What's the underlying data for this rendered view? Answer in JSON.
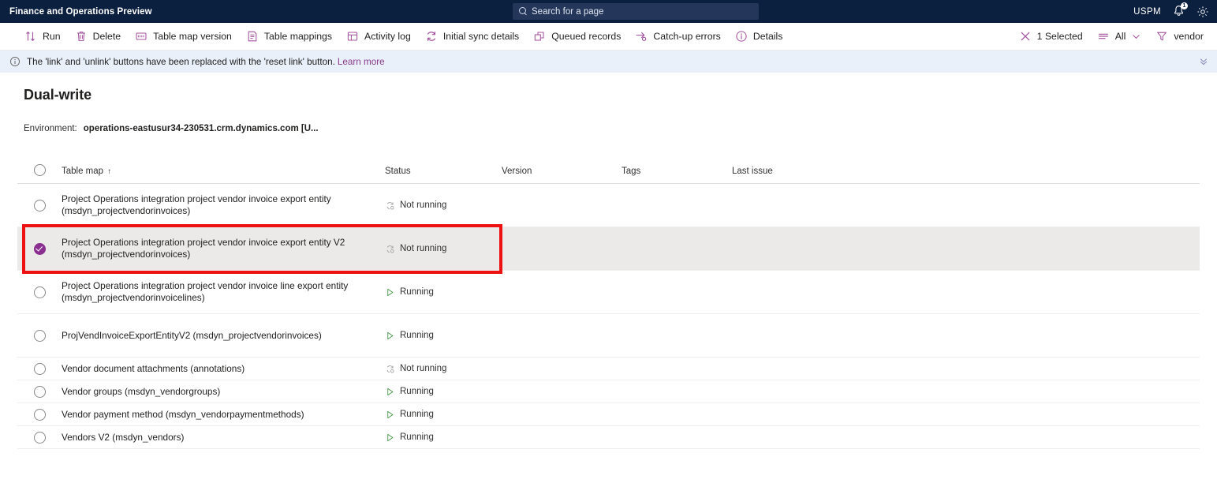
{
  "topbar": {
    "app_title": "Finance and Operations Preview",
    "search_placeholder": "Search for a page",
    "search_icon": "search-icon",
    "user_initials": "USPM",
    "notification_icon": "bell-icon",
    "notification_count": "1",
    "settings_icon": "gear-icon",
    "bg_color": "#0b1f3f"
  },
  "toolbar": {
    "items": [
      {
        "label": "Run",
        "icon": "sort-arrows-icon"
      },
      {
        "label": "Delete",
        "icon": "trash-icon"
      },
      {
        "label": "Table map version",
        "icon": "version-card-icon"
      },
      {
        "label": "Table mappings",
        "icon": "list-document-icon"
      },
      {
        "label": "Activity log",
        "icon": "activity-grid-icon"
      },
      {
        "label": "Initial sync details",
        "icon": "sync-refresh-icon"
      },
      {
        "label": "Queued records",
        "icon": "stacked-squares-icon"
      },
      {
        "label": "Catch-up errors",
        "icon": "arrow-target-icon"
      },
      {
        "label": "Details",
        "icon": "info-circle-icon"
      }
    ],
    "right_items": [
      {
        "label": "1 Selected",
        "icon": "close-x-icon"
      },
      {
        "label": "All",
        "icon": "filter-lines-icon",
        "chevron": "chevron-down-icon"
      },
      {
        "label": "vendor",
        "icon": "funnel-filter-icon"
      }
    ],
    "icon_color": "#a4519f"
  },
  "message_bar": {
    "icon": "info-circle-icon",
    "text": "The 'link' and 'unlink' buttons have been replaced with the 'reset link' button.",
    "link_text": "Learn more",
    "collapse_icon": "double-chevron-down-icon",
    "bg_color": "#e9f0fa"
  },
  "page": {
    "title": "Dual-write",
    "environment_label": "Environment:",
    "environment_value": "operations-eastusur34-230531.crm.dynamics.com [U..."
  },
  "grid": {
    "columns": [
      {
        "key": "check",
        "label": ""
      },
      {
        "key": "name",
        "label": "Table map",
        "sort": "↑"
      },
      {
        "key": "status",
        "label": "Status"
      },
      {
        "key": "version",
        "label": "Version"
      },
      {
        "key": "tags",
        "label": "Tags"
      },
      {
        "key": "issue",
        "label": "Last issue"
      }
    ],
    "rows": [
      {
        "name": "Project Operations integration project vendor invoice export entity (msdyn_projectvendorinvoices)",
        "status": "Not running",
        "status_icon": "not-running-icon",
        "version": "",
        "tags": "",
        "last_issue": "",
        "selected": false,
        "tall": true
      },
      {
        "name": "Project Operations integration project vendor invoice export entity V2 (msdyn_projectvendorinvoices)",
        "status": "Not running",
        "status_icon": "not-running-icon",
        "version": "",
        "tags": "",
        "last_issue": "",
        "selected": true,
        "tall": true
      },
      {
        "name": "Project Operations integration project vendor invoice line export entity (msdyn_projectvendorinvoicelines)",
        "status": "Running",
        "status_icon": "running-play-icon",
        "version": "",
        "tags": "",
        "last_issue": "",
        "selected": false,
        "tall": true
      },
      {
        "name": "ProjVendInvoiceExportEntityV2 (msdyn_projectvendorinvoices)",
        "status": "Running",
        "status_icon": "running-play-icon",
        "version": "",
        "tags": "",
        "last_issue": "",
        "selected": false,
        "tall": true
      },
      {
        "name": "Vendor document attachments (annotations)",
        "status": "Not running",
        "status_icon": "not-running-icon",
        "version": "",
        "tags": "",
        "last_issue": "",
        "selected": false,
        "tall": false
      },
      {
        "name": "Vendor groups (msdyn_vendorgroups)",
        "status": "Running",
        "status_icon": "running-play-icon",
        "version": "",
        "tags": "",
        "last_issue": "",
        "selected": false,
        "tall": false
      },
      {
        "name": "Vendor payment method (msdyn_vendorpaymentmethods)",
        "status": "Running",
        "status_icon": "running-play-icon",
        "version": "",
        "tags": "",
        "last_issue": "",
        "selected": false,
        "tall": false
      },
      {
        "name": "Vendors V2 (msdyn_vendors)",
        "status": "Running",
        "status_icon": "running-play-icon",
        "version": "",
        "tags": "",
        "last_issue": "",
        "selected": false,
        "tall": false
      }
    ]
  },
  "annotation": {
    "highlight_color": "#ee1111",
    "target_row_index": 1
  }
}
